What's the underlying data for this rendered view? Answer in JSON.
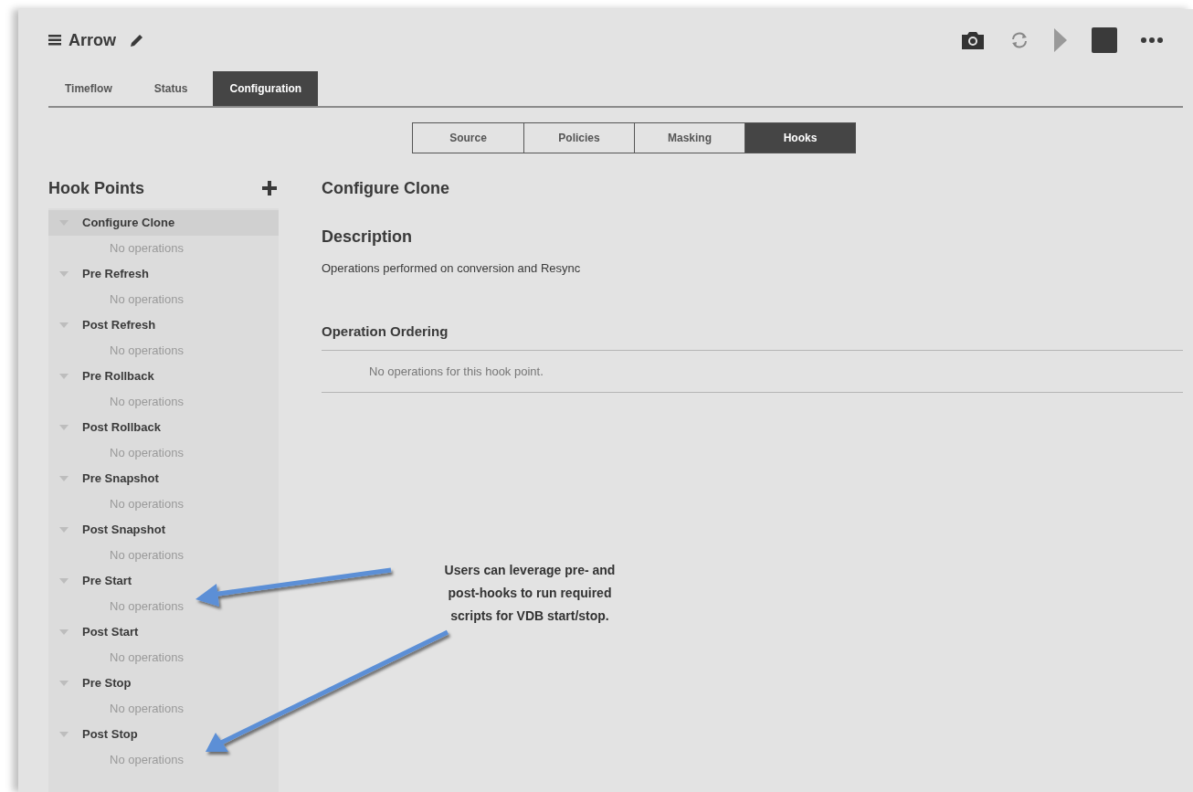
{
  "header": {
    "title": "Arrow"
  },
  "tabs": [
    {
      "label": "Timeflow",
      "selected": false
    },
    {
      "label": "Status",
      "selected": false
    },
    {
      "label": "Configuration",
      "selected": true
    }
  ],
  "subtabs": [
    {
      "label": "Source",
      "selected": false
    },
    {
      "label": "Policies",
      "selected": false
    },
    {
      "label": "Masking",
      "selected": false
    },
    {
      "label": "Hooks",
      "selected": true
    }
  ],
  "sidebar": {
    "title": "Hook Points",
    "items": [
      {
        "label": "Configure Clone",
        "detail": "No operations",
        "selected": true
      },
      {
        "label": "Pre Refresh",
        "detail": "No operations",
        "selected": false
      },
      {
        "label": "Post Refresh",
        "detail": "No operations",
        "selected": false
      },
      {
        "label": "Pre Rollback",
        "detail": "No operations",
        "selected": false
      },
      {
        "label": "Post Rollback",
        "detail": "No operations",
        "selected": false
      },
      {
        "label": "Pre Snapshot",
        "detail": "No operations",
        "selected": false
      },
      {
        "label": "Post Snapshot",
        "detail": "No operations",
        "selected": false
      },
      {
        "label": "Pre Start",
        "detail": "No operations",
        "selected": false
      },
      {
        "label": "Post Start",
        "detail": "No operations",
        "selected": false
      },
      {
        "label": "Pre Stop",
        "detail": "No operations",
        "selected": false
      },
      {
        "label": "Post Stop",
        "detail": "No operations",
        "selected": false
      }
    ]
  },
  "detail": {
    "title": "Configure Clone",
    "description_heading": "Description",
    "description": "Operations performed on conversion and Resync",
    "ordering_heading": "Operation Ordering",
    "empty_message": "No operations for this hook point."
  },
  "annotation": {
    "lines": [
      "Users can leverage pre- and",
      "post-hooks to run required",
      "scripts for VDB start/stop."
    ]
  }
}
